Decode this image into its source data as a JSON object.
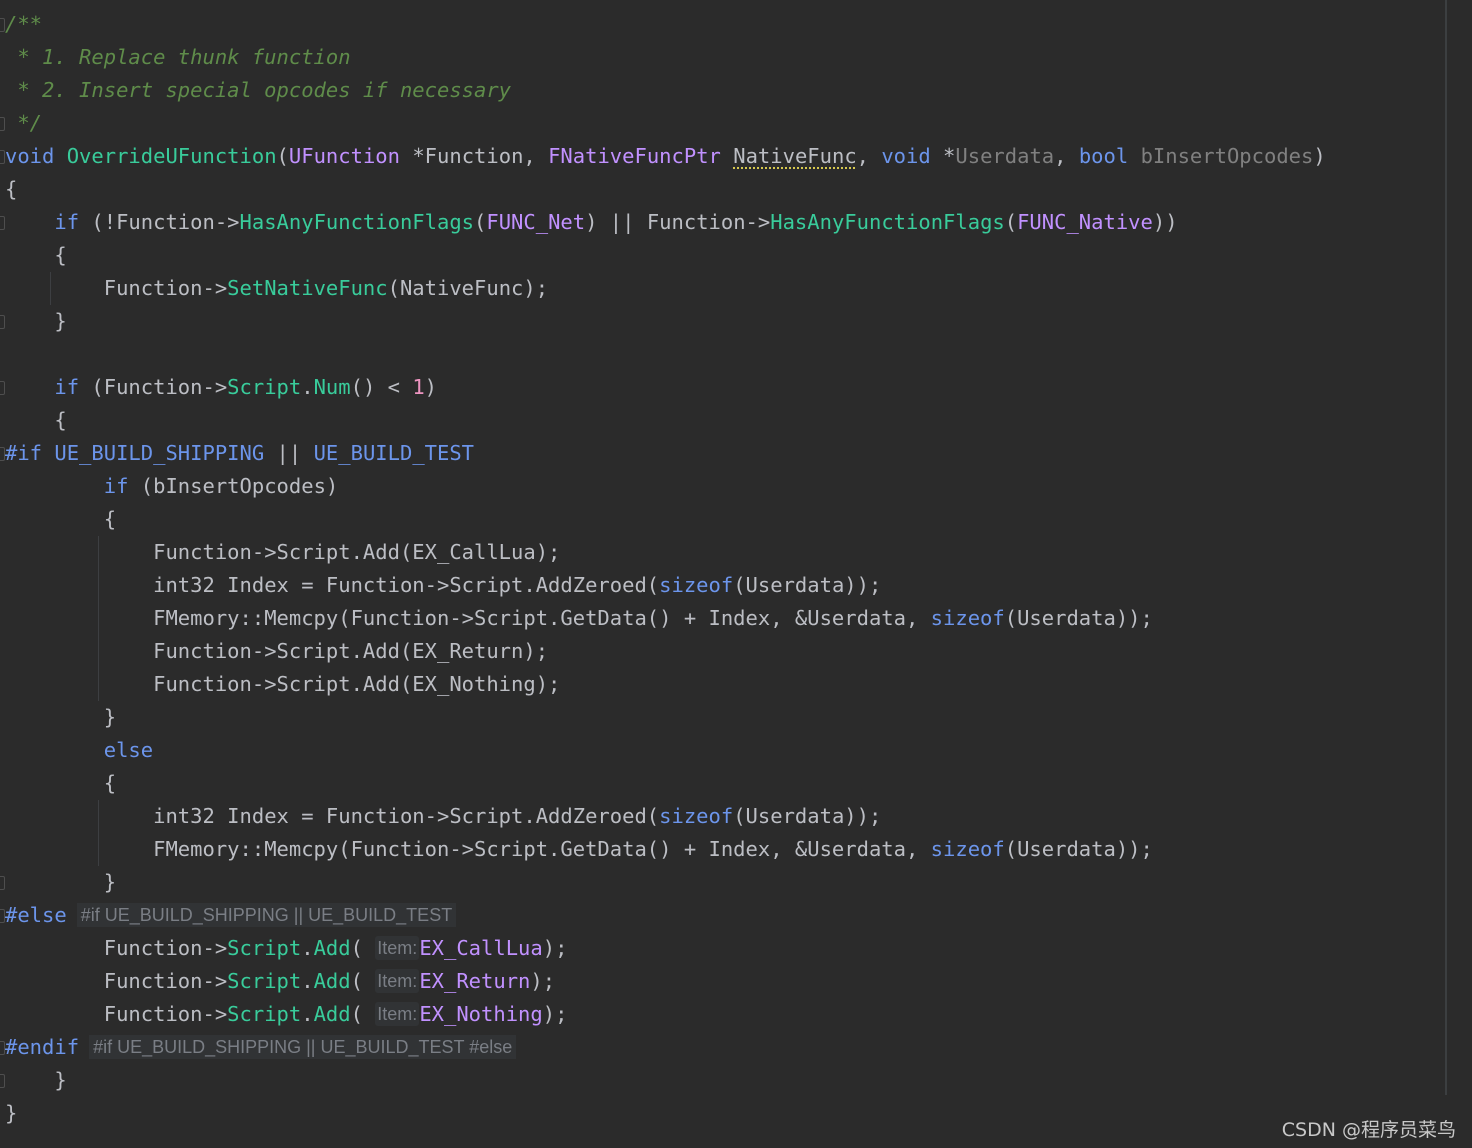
{
  "editor": {
    "comment": {
      "open": "/**",
      "line1": " * 1. Replace thunk function",
      "line2": " * 2. Insert special opcodes if necessary",
      "close": " */"
    },
    "signature": {
      "ret": "void",
      "name": "OverrideUFunction",
      "open_paren": "(",
      "t1": "UFunction",
      "p1": " *Function, ",
      "t2": "FNativeFuncPtr",
      "sp": " ",
      "p2": "NativeFunc",
      "sep2": ", ",
      "t3": "void",
      "p3_star": " *",
      "p3": "Userdata",
      "sep3": ", ",
      "t4": "bool",
      "p4_sp": " ",
      "p4": "bInsertOpcodes",
      "close_paren": ")"
    },
    "brace_open": "{",
    "brace_close": "}",
    "indent1": "    ",
    "indent2": "        ",
    "indent3": "            ",
    "if1": {
      "kw": "if",
      "a": " (!Function->",
      "fn1": "HasAnyFunctionFlags",
      "b": "(",
      "m1": "FUNC_Net",
      "c": ") || Function->",
      "fn2": "HasAnyFunctionFlags",
      "d": "(",
      "m2": "FUNC_Native",
      "e": "))"
    },
    "setnative": {
      "a": "Function->",
      "fn": "SetNativeFunc",
      "b": "(NativeFunc);"
    },
    "if2": {
      "kw": "if",
      "a": " (Function->",
      "f1": "Script",
      "dot": ".",
      "f2": "Num",
      "b": "() < ",
      "num": "1",
      "c": ")"
    },
    "pp_if": {
      "kw": "#if",
      "sp": " ",
      "m1": "UE_BUILD_SHIPPING",
      "or": " || ",
      "m2": "UE_BUILD_TEST"
    },
    "if3": {
      "kw": "if",
      "a": " (bInsertOpcodes)"
    },
    "block1": {
      "l1": "Function->Script.Add(EX_CallLua);",
      "l2a": "int32 Index = Function->Script.AddZeroed(",
      "l2kw": "sizeof",
      "l2b": "(Userdata));",
      "l3a": "FMemory::Memcpy(Function->Script.GetData() + Index, &Userdata, ",
      "l3kw": "sizeof",
      "l3b": "(Userdata));",
      "l4": "Function->Script.Add(EX_Return);",
      "l5": "Function->Script.Add(EX_Nothing);"
    },
    "else_kw": "else",
    "block2": {
      "l1a": "int32 Index = Function->Script.AddZeroed(",
      "l1kw": "sizeof",
      "l1b": "(Userdata));",
      "l2a": "FMemory::Memcpy(Function->Script.GetData() + Index, &Userdata, ",
      "l2kw": "sizeof",
      "l2b": "(Userdata));"
    },
    "pp_else": {
      "kw": "#else",
      "hint": "#if UE_BUILD_SHIPPING || UE_BUILD_TEST"
    },
    "adds": {
      "pre": "Function->",
      "script": "Script",
      "dot": ".",
      "add": "Add",
      "open": "(",
      "hint": "Item:",
      "v1": "EX_CallLua",
      "v2": "EX_Return",
      "v3": "EX_Nothing",
      "close": ");"
    },
    "pp_endif": {
      "kw": "#endif",
      "hint": "#if UE_BUILD_SHIPPING || UE_BUILD_TEST #else"
    }
  },
  "watermark": "CSDN @程序员菜鸟",
  "colors": {
    "background": "#2b2b2b",
    "keyword": "#6c95eb",
    "function": "#39cc9b",
    "type_macro": "#c191ff",
    "comment": "#5f8c4a",
    "number": "#ed94c0",
    "text": "#bcbec4",
    "dim_param": "#808080"
  }
}
